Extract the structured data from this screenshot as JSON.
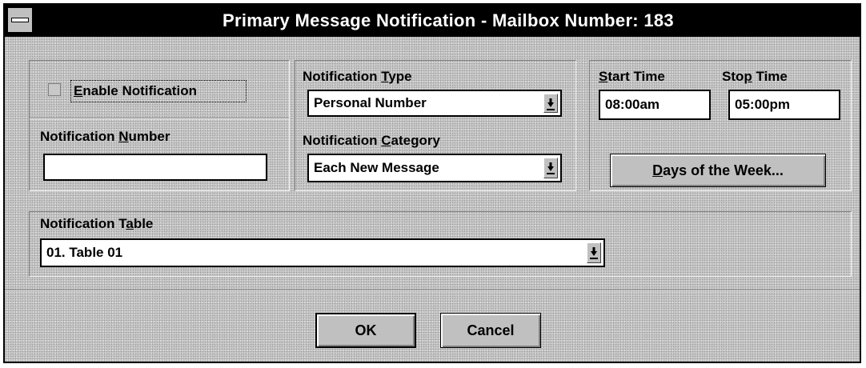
{
  "window": {
    "title": "Primary Message Notification - Mailbox Number:  183"
  },
  "enable_notification": {
    "prefix": "",
    "accel": "E",
    "rest": "nable Notification",
    "checked": false
  },
  "notification_number": {
    "label_prefix": "Notification ",
    "label_accel": "N",
    "label_rest": "umber",
    "value": ""
  },
  "notification_type": {
    "label_prefix": "Notification ",
    "label_accel": "T",
    "label_rest": "ype",
    "value": "Personal Number"
  },
  "notification_category": {
    "label_prefix": "Notification ",
    "label_accel": "C",
    "label_rest": "ategory",
    "value": "Each New Message"
  },
  "start_time": {
    "label_accel": "S",
    "label_rest": "tart Time",
    "value": "08:00am"
  },
  "stop_time": {
    "label_prefix": "Sto",
    "label_accel": "p",
    "label_rest": " Time",
    "value": "05:00pm"
  },
  "days_button": {
    "accel": "D",
    "rest": "ays of the Week..."
  },
  "notification_table": {
    "label_prefix": "Notification T",
    "label_accel": "a",
    "label_rest": "ble",
    "value": "01.  Table 01"
  },
  "buttons": {
    "ok": "OK",
    "cancel": "Cancel"
  },
  "icons": {
    "system_menu": "system-menu-icon",
    "dropdown_arrow": "down-arrow-icon"
  },
  "colors": {
    "title_bar": "#000000",
    "title_text": "#ffffff",
    "dialog_face": "#c0c0c0"
  }
}
